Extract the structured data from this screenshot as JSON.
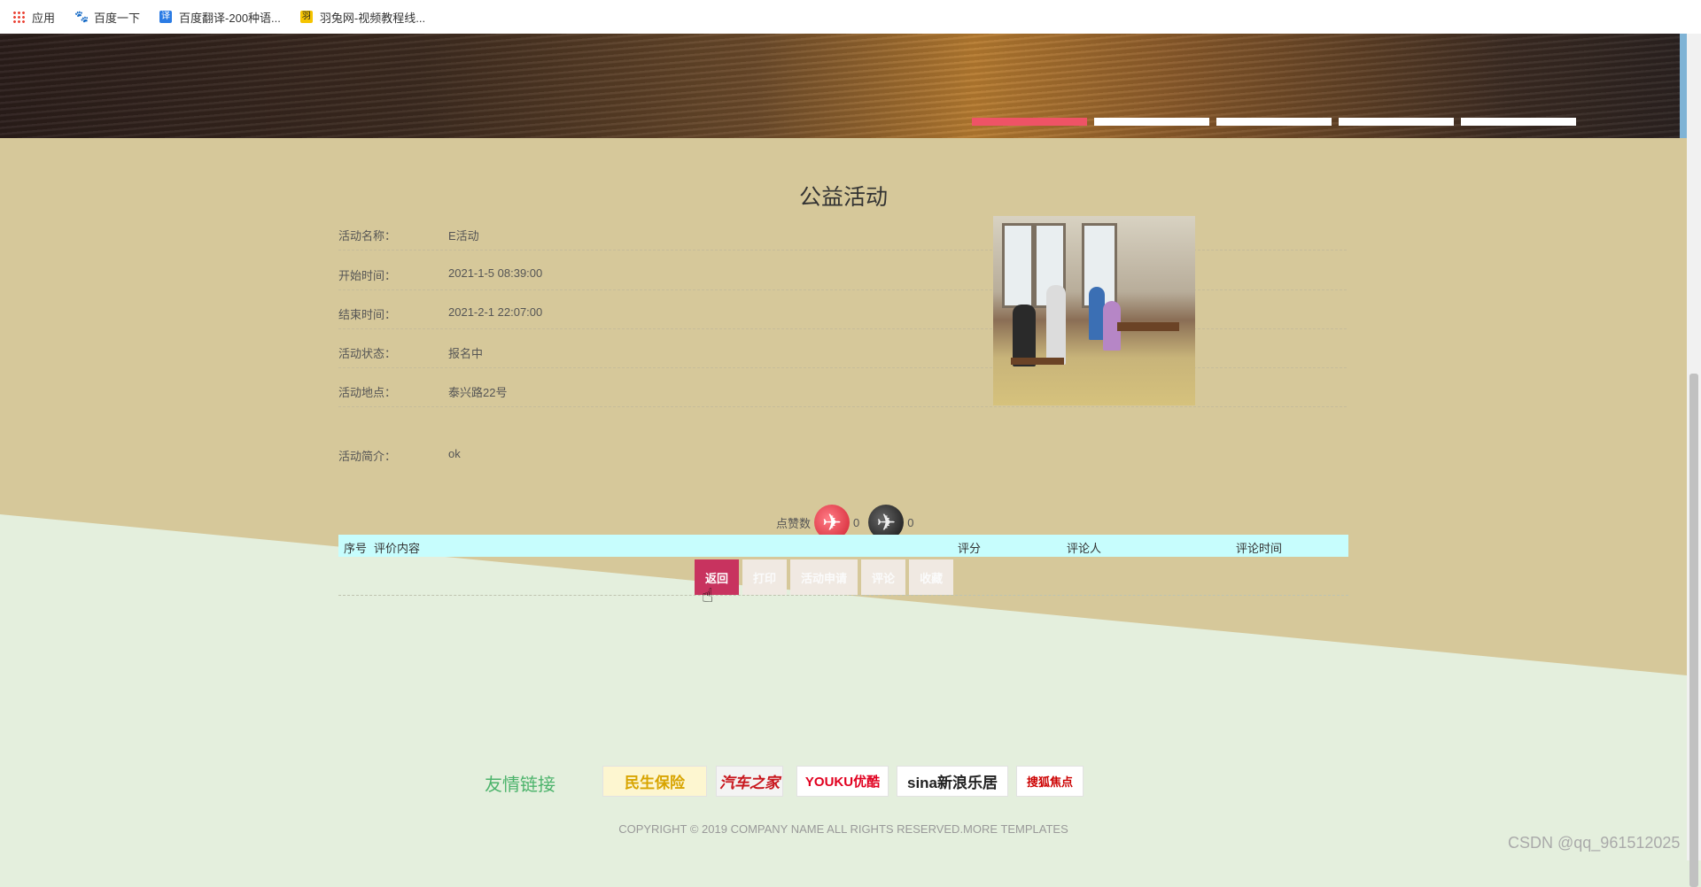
{
  "bookmarks": [
    {
      "label": "应用",
      "icon": "apps-grid-icon"
    },
    {
      "label": "百度一下",
      "icon": "baidu-paw-icon"
    },
    {
      "label": "百度翻译-200种语...",
      "icon": "translate-icon"
    },
    {
      "label": "羽兔网-视频教程线...",
      "icon": "yutu-icon"
    }
  ],
  "banner": {
    "slides_total": 5,
    "active_slide": 1
  },
  "page": {
    "title": "公益活动"
  },
  "activity": {
    "fields": [
      {
        "label": "活动名称：",
        "value": "E活动"
      },
      {
        "label": "开始时间：",
        "value": "2021-1-5 08:39:00"
      },
      {
        "label": "结束时间：",
        "value": "2021-2-1 22:07:00"
      },
      {
        "label": "活动状态：",
        "value": "报名中"
      },
      {
        "label": "活动地点：",
        "value": "泰兴路22号"
      }
    ],
    "intro": {
      "label": "活动简介：",
      "value": "ok"
    }
  },
  "likes": {
    "label": "点赞数",
    "up_count": "0",
    "down_count": "0"
  },
  "comments": {
    "headers": [
      "序号",
      "评价内容",
      "评分",
      "评论人",
      "评论时间"
    ]
  },
  "buttons": {
    "back": "返回",
    "print": "打印",
    "apply": "活动申请",
    "comment": "评论",
    "favorite": "收藏"
  },
  "footer": {
    "friend_links_title": "友情链接",
    "logos": [
      "民生保险",
      "汽车之家",
      "YOUKU优酷",
      "sina新浪乐居",
      "搜狐焦点"
    ],
    "copyright": "COPYRIGHT © 2019 COMPANY NAME ALL RIGHTS RESERVED.MORE TEMPLATES"
  },
  "watermark": "CSDN @qq_961512025",
  "colors": {
    "main_bg_tan": "#d6c89a",
    "main_bg_green": "#e4efdd",
    "active_dot": "#ee5366",
    "back_button": "#c8335f",
    "table_header": "#c7fdfd",
    "friend_links": "#4cb36b"
  }
}
